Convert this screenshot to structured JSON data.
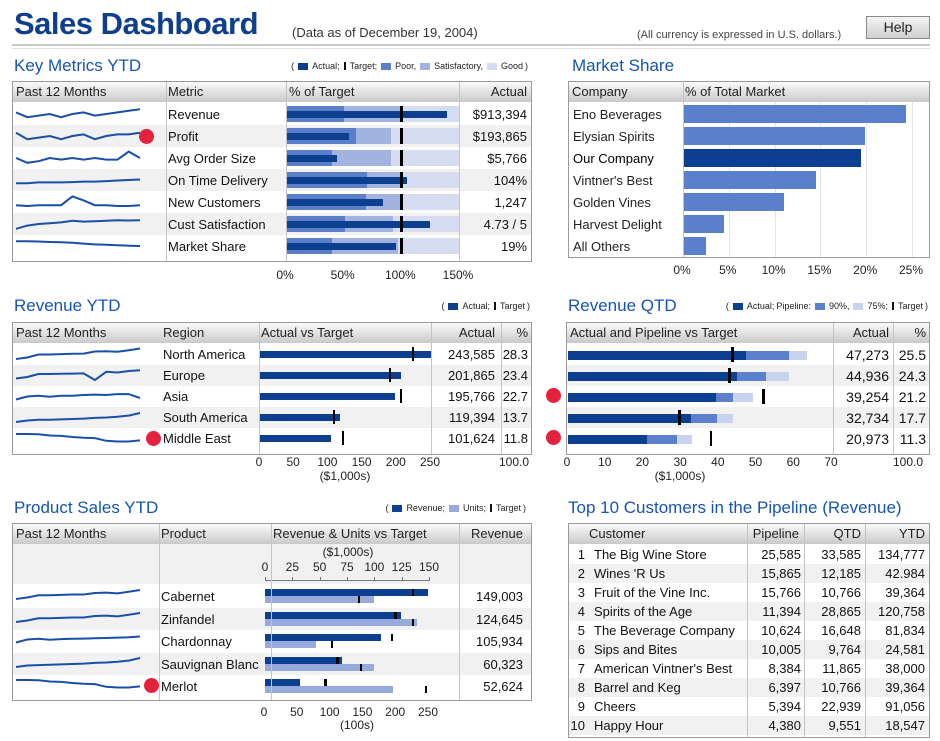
{
  "header": {
    "title": "Sales Dashboard",
    "subtitle": "(Data as of December 19, 2004)",
    "currency_note": "(All currency is expressed in U.S. dollars.)",
    "help_label": "Help"
  },
  "colors": {
    "actual": "#0c3f90",
    "poor": "#5a7ec8",
    "satisfactory": "#a2b3df",
    "good": "#d6ddf0",
    "alert": "#e3223d",
    "title": "#1654b4",
    "pipeline90": "#5b80cc",
    "pipeline75": "#c9d3ee",
    "units": "#98a9dc",
    "market": "#5a7fcb",
    "market_ours": "#0c3f90"
  },
  "key_metrics": {
    "title": "Key Metrics YTD",
    "legend": {
      "open": "(",
      "actual": "Actual;",
      "target": "Target;",
      "poor": "Poor,",
      "satisfactory": "Satisfactory,",
      "good": "Good",
      "close": ")"
    },
    "columns": [
      "Past 12 Months",
      "Metric",
      "% of Target",
      "Actual"
    ],
    "axis": [
      "0%",
      "50%",
      "100%",
      "150%"
    ],
    "axis_max": 150,
    "rows": [
      {
        "metric": "Revenue",
        "actual": "$913,394",
        "pct": 140,
        "target": 100,
        "poor": 50,
        "satisfactory": 100,
        "alert": false,
        "trend": [
          6,
          3,
          4,
          5,
          3,
          5,
          6,
          4,
          5,
          6,
          7,
          8
        ]
      },
      {
        "metric": "Profit",
        "actual": "$193,865",
        "pct": 55,
        "target": 100,
        "poor": 61,
        "satisfactory": 91,
        "alert": true,
        "trend": [
          7,
          3,
          4,
          5,
          3,
          5,
          6,
          3,
          5,
          6,
          6,
          7
        ]
      },
      {
        "metric": "Avg Order Size",
        "actual": "$5,766",
        "pct": 44,
        "target": 100,
        "poor": 40,
        "satisfactory": 91,
        "alert": false,
        "trend": [
          5,
          2,
          3,
          5,
          4,
          5,
          4,
          5,
          4,
          4,
          9,
          5
        ]
      },
      {
        "metric": "On Time Delivery",
        "actual": "104%",
        "pct": 105,
        "target": 100,
        "poor": 70,
        "satisfactory": 100,
        "alert": false,
        "trend": [
          3,
          3,
          3.5,
          3.5,
          3.5,
          3.7,
          4,
          4,
          4.3,
          4.7,
          5,
          5.3
        ]
      },
      {
        "metric": "New Customers",
        "actual": "1,247",
        "pct": 84,
        "target": 100,
        "poor": 69,
        "satisfactory": 100,
        "alert": false,
        "trend": [
          3,
          2.5,
          3,
          3,
          3,
          8.5,
          6,
          3,
          3,
          2.5,
          2.5,
          3
        ]
      },
      {
        "metric": "Cust Satisfaction",
        "actual": "4.73 / 5",
        "pct": 125,
        "target": 100,
        "poor": 51,
        "satisfactory": 93,
        "alert": false,
        "trend": [
          2,
          4,
          5,
          5.5,
          6,
          7,
          6.5,
          6.7,
          7,
          7.3,
          7.2,
          7.3
        ]
      },
      {
        "metric": "Market Share",
        "actual": "19%",
        "pct": 95,
        "target": 100,
        "poor": 40,
        "satisfactory": 97,
        "alert": false,
        "trend": [
          8,
          8,
          7.8,
          7.5,
          7.3,
          7,
          6.5,
          6,
          5.8,
          5.5,
          5.2,
          5
        ]
      }
    ]
  },
  "market_share": {
    "title": "Market Share",
    "columns": [
      "Company",
      "% of Total Market"
    ],
    "axis": [
      "0%",
      "5%",
      "10%",
      "15%",
      "20%",
      "25%"
    ],
    "axis_max": 27,
    "rows": [
      {
        "company": "Eno Beverages",
        "value": 24.3,
        "ours": false
      },
      {
        "company": "Elysian Spirits",
        "value": 19.9,
        "ours": false
      },
      {
        "company": "Our Company",
        "value": 19.4,
        "ours": true
      },
      {
        "company": "Vintner's Best",
        "value": 14.5,
        "ours": false
      },
      {
        "company": "Golden Vines",
        "value": 11.0,
        "ours": false
      },
      {
        "company": "Harvest Delight",
        "value": 4.5,
        "ours": false
      },
      {
        "company": "All Others",
        "value": 2.5,
        "ours": false
      }
    ]
  },
  "revenue_ytd": {
    "title": "Revenue YTD",
    "legend": {
      "open": "(",
      "actual": "Actual;",
      "target": "Target",
      "close": ")"
    },
    "columns": [
      "Past 12 Months",
      "Region",
      "Actual vs Target",
      "Actual",
      "%"
    ],
    "axis": [
      "0",
      "50",
      "100",
      "150",
      "200",
      "250"
    ],
    "axis_max": 250,
    "axis_unit": "($1,000s)",
    "pct_total": "100.0",
    "rows": [
      {
        "region": "North America",
        "actual": "243,585",
        "pct": "28.3",
        "value": 250,
        "target": 223,
        "alert": false,
        "trend": [
          2,
          3,
          5,
          5,
          5.3,
          5.5,
          5.6,
          7,
          7.2,
          6.8,
          7.8,
          9
        ]
      },
      {
        "region": "Europe",
        "actual": "201,865",
        "pct": "23.4",
        "value": 206,
        "target": 190,
        "alert": false,
        "trend": [
          3,
          4,
          6,
          6,
          6.2,
          6.3,
          6.4,
          2,
          7.5,
          7,
          8,
          8.5
        ]
      },
      {
        "region": "Asia",
        "actual": "195,766",
        "pct": "22.7",
        "value": 198,
        "target": 206,
        "alert": false,
        "trend": [
          3,
          5,
          5.5,
          4.8,
          5.5,
          5.5,
          6,
          6.3,
          6,
          6.6,
          6.6,
          4
        ]
      },
      {
        "region": "South America",
        "actual": "119,394",
        "pct": "13.7",
        "value": 117,
        "target": 108,
        "alert": false,
        "trend": [
          2,
          3,
          3.5,
          3.5,
          3.7,
          4,
          4.3,
          4.7,
          5,
          5.5,
          6.3,
          8
        ]
      },
      {
        "region": "Middle East",
        "actual": "101,624",
        "pct": "11.8",
        "value": 104,
        "target": 121,
        "alert": true,
        "trend": [
          8,
          8,
          7.8,
          7,
          6.7,
          6,
          5.5,
          5.3,
          3.5,
          3,
          3,
          3.7
        ]
      }
    ]
  },
  "revenue_qtd": {
    "title": "Revenue QTD",
    "legend": {
      "open": "(",
      "actual": "Actual;",
      "pipeline": "Pipeline:",
      "p90": "90%,",
      "p75": "75%;",
      "target": "Target",
      "close": ")"
    },
    "columns": [
      "Actual and Pipeline vs Target",
      "Actual",
      "%"
    ],
    "axis": [
      "0",
      "10",
      "20",
      "30",
      "40",
      "50",
      "60",
      "70"
    ],
    "axis_max": 70,
    "axis_unit": "($1,000s)",
    "pct_total": "100.0",
    "rows": [
      {
        "actual": "47,273",
        "pct": "25.5",
        "value": 47.3,
        "pipeline90": 58.5,
        "pipeline75": 63.5,
        "target": 43.5,
        "alert": false
      },
      {
        "actual": "44,936",
        "pct": "24.3",
        "value": 44.9,
        "pipeline90": 52.5,
        "pipeline75": 58.5,
        "target": 42.8,
        "alert": false
      },
      {
        "actual": "39,254",
        "pct": "21.2",
        "value": 39.3,
        "pipeline90": 43.8,
        "pipeline75": 49,
        "target": 51.8,
        "alert": true
      },
      {
        "actual": "32,734",
        "pct": "17.7",
        "value": 32.7,
        "pipeline90": 39.5,
        "pipeline75": 43.8,
        "target": 29.5,
        "alert": false
      },
      {
        "actual": "20,973",
        "pct": "11.3",
        "value": 21,
        "pipeline90": 29,
        "pipeline75": 33,
        "target": 37.8,
        "alert": true
      }
    ]
  },
  "product_sales": {
    "title": "Product Sales YTD",
    "legend": {
      "open": "(",
      "revenue": "Revenue;",
      "units": "Units;",
      "target": "Target",
      "close": ")"
    },
    "columns": [
      "Past 12 Months",
      "Product",
      "Revenue & Units vs Target",
      "Revenue"
    ],
    "revenue_axis": [
      "0",
      "25",
      "50",
      "75",
      "100",
      "125",
      "150"
    ],
    "revenue_axis_max": 150,
    "revenue_unit": "($1,000s)",
    "units_axis": [
      "0",
      "50",
      "100",
      "150",
      "200",
      "250"
    ],
    "units_axis_max": 250,
    "units_unit": "(100s)",
    "rows": [
      {
        "product": "Cabernet",
        "revenue": "149,003",
        "rev_value": 149,
        "rev_target": 135,
        "units": 166,
        "units_target": 143,
        "alert": false,
        "trend": [
          2,
          3,
          4.5,
          4.5,
          4.7,
          5,
          5,
          6,
          6.3,
          5.7,
          6.8,
          8
        ]
      },
      {
        "product": "Zinfandel",
        "revenue": "124,645",
        "rev_value": 124.6,
        "rev_target": 119,
        "units": 232,
        "units_target": 225,
        "alert": false,
        "trend": [
          2,
          3,
          4.5,
          4.5,
          4.7,
          5,
          5,
          6,
          6.3,
          5.7,
          6.8,
          8
        ]
      },
      {
        "product": "Chardonnay",
        "revenue": "105,934",
        "rev_value": 106,
        "rev_target": 116,
        "units": 78,
        "units_target": 102,
        "alert": false,
        "trend": [
          3,
          5,
          5.5,
          4.8,
          5.3,
          5.5,
          5.6,
          5.8,
          6,
          6.3,
          6.5,
          7
        ]
      },
      {
        "product": "Sauvignan Blanc",
        "revenue": "60,323",
        "rev_value": 70,
        "rev_target": 66,
        "units": 166,
        "units_target": 146,
        "alert": false,
        "trend": [
          2,
          3,
          3.3,
          3.5,
          3.7,
          4,
          4.3,
          4.7,
          5,
          5.5,
          6.3,
          8
        ]
      },
      {
        "product": "Merlot",
        "revenue": "52,624",
        "rev_value": 32,
        "rev_target": 55,
        "units": 195,
        "units_target": 245,
        "alert": true,
        "trend": [
          8,
          8,
          7.8,
          7,
          6.7,
          6,
          5.5,
          5.3,
          3.5,
          3,
          3,
          3.7
        ]
      }
    ]
  },
  "top_customers": {
    "title": "Top 10 Customers in the Pipeline (Revenue)",
    "columns": [
      "Customer",
      "Pipeline",
      "QTD",
      "YTD"
    ],
    "rows": [
      {
        "rank": "1",
        "customer": "The Big Wine Store",
        "pipeline": "25,585",
        "qtd": "33,585",
        "ytd": "134,777"
      },
      {
        "rank": "2",
        "customer": "Wines 'R Us",
        "pipeline": "15,865",
        "qtd": "12,185",
        "ytd": "42.984"
      },
      {
        "rank": "3",
        "customer": "Fruit of the Vine Inc.",
        "pipeline": "15,766",
        "qtd": "10,766",
        "ytd": "39,364"
      },
      {
        "rank": "4",
        "customer": "Spirits of the Age",
        "pipeline": "11,394",
        "qtd": "28,865",
        "ytd": "120,758"
      },
      {
        "rank": "5",
        "customer": "The Beverage Company",
        "pipeline": "10,624",
        "qtd": "16,648",
        "ytd": "81,834"
      },
      {
        "rank": "6",
        "customer": "Sips and Bites",
        "pipeline": "10,005",
        "qtd": "9,764",
        "ytd": "24,581"
      },
      {
        "rank": "7",
        "customer": "American Vintner's Best",
        "pipeline": "8,384",
        "qtd": "11,865",
        "ytd": "38,000"
      },
      {
        "rank": "8",
        "customer": "Barrel and Keg",
        "pipeline": "6,397",
        "qtd": "10,766",
        "ytd": "39,364"
      },
      {
        "rank": "9",
        "customer": "Cheers",
        "pipeline": "5,394",
        "qtd": "22,939",
        "ytd": "91,056"
      },
      {
        "rank": "10",
        "customer": "Happy Hour",
        "pipeline": "4,380",
        "qtd": "9,551",
        "ytd": "18,547"
      }
    ]
  }
}
